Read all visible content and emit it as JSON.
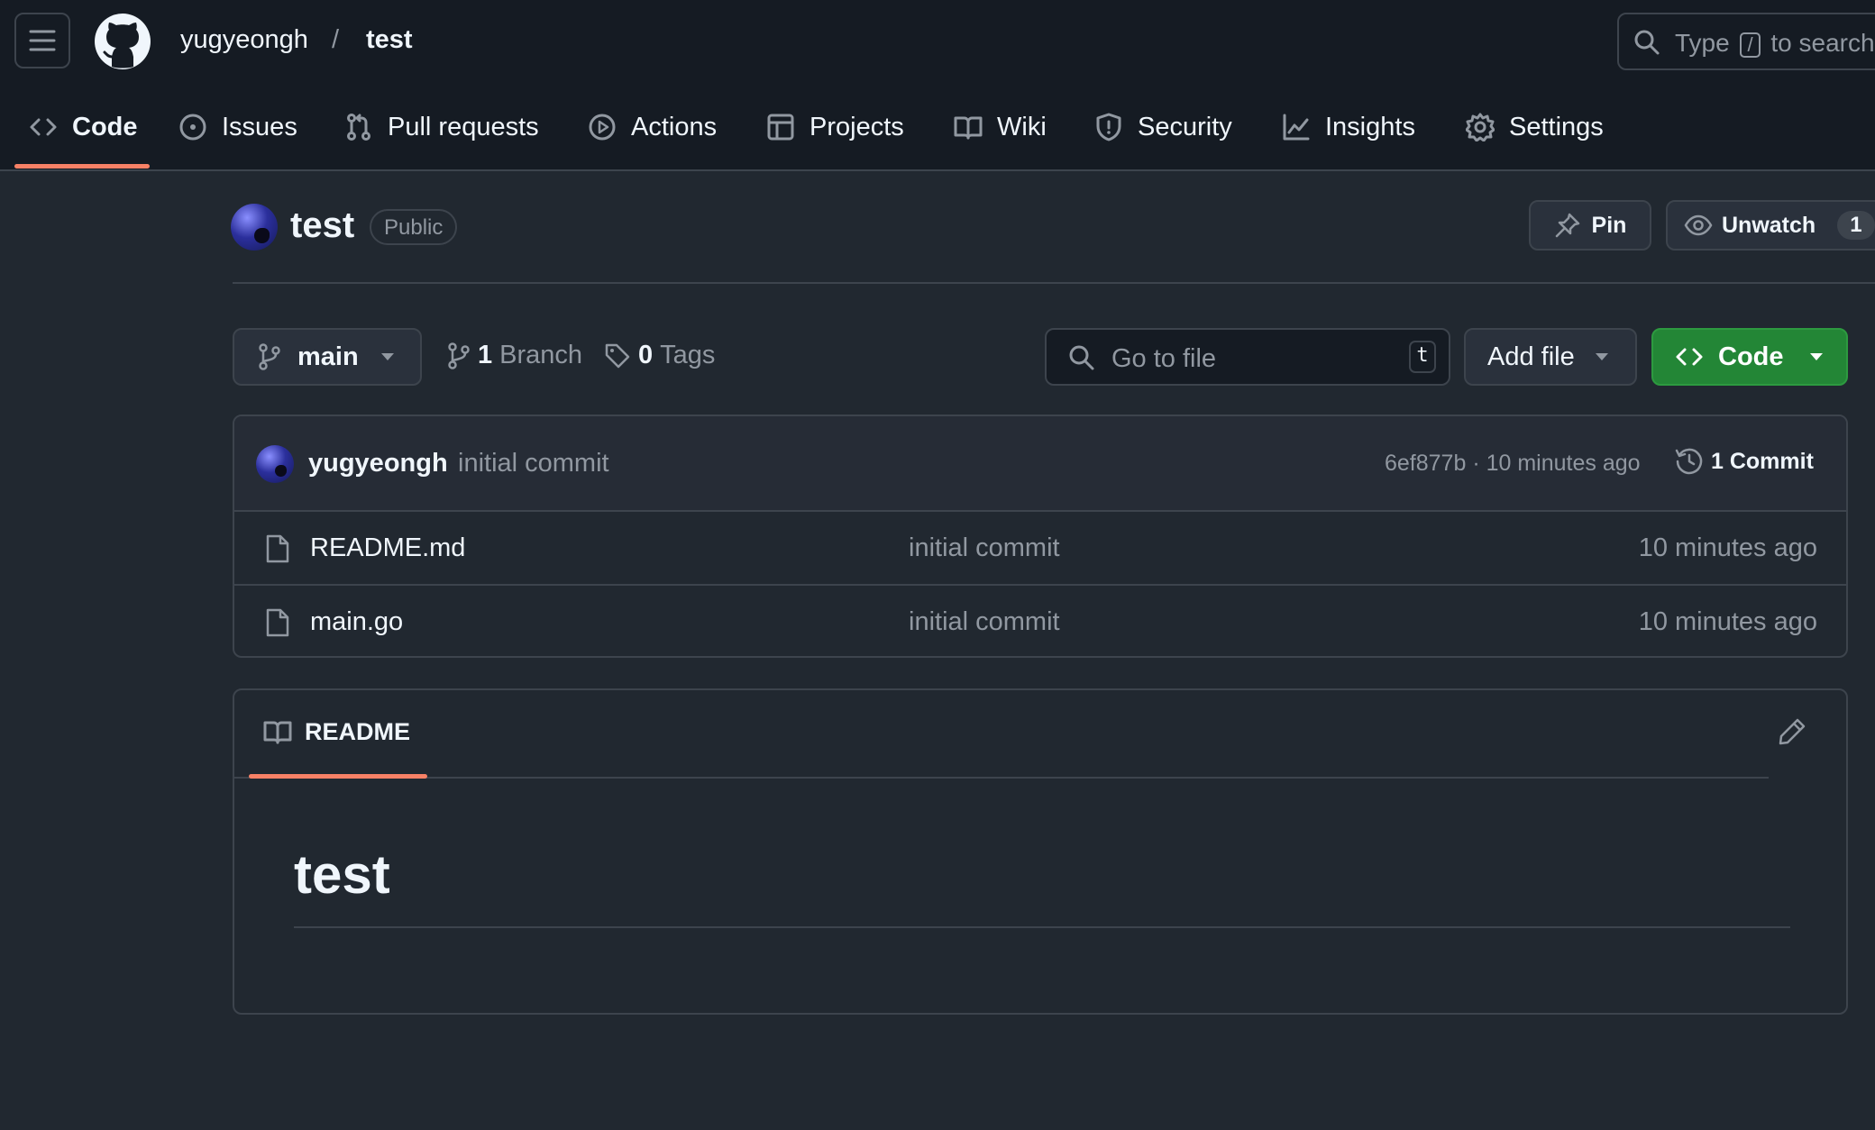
{
  "header": {
    "owner": "yugyeongh",
    "separator": "/",
    "repo": "test",
    "search_prefix": "Type",
    "search_key": "/",
    "search_suffix": "to search"
  },
  "nav": {
    "tabs": [
      {
        "label": "Code",
        "icon": "code-icon",
        "active": true
      },
      {
        "label": "Issues",
        "icon": "issue-icon"
      },
      {
        "label": "Pull requests",
        "icon": "pull-request-icon"
      },
      {
        "label": "Actions",
        "icon": "play-icon"
      },
      {
        "label": "Projects",
        "icon": "table-icon"
      },
      {
        "label": "Wiki",
        "icon": "book-icon"
      },
      {
        "label": "Security",
        "icon": "shield-icon"
      },
      {
        "label": "Insights",
        "icon": "graph-icon"
      },
      {
        "label": "Settings",
        "icon": "gear-icon"
      }
    ]
  },
  "repo": {
    "name": "test",
    "visibility": "Public",
    "pin_label": "Pin",
    "unwatch_label": "Unwatch",
    "watch_count": "1"
  },
  "toolbar": {
    "branch": "main",
    "branch_count": "1",
    "branch_label": "Branch",
    "tag_count": "0",
    "tag_label": "Tags",
    "goto_placeholder": "Go to file",
    "goto_key": "t",
    "add_file_label": "Add file",
    "code_label": "Code"
  },
  "commit": {
    "author": "yugyeongh",
    "message": "initial commit",
    "meta": "6ef877b · 10 minutes ago",
    "count_label": "1 Commit"
  },
  "files": [
    {
      "name": "README.md",
      "message": "initial commit",
      "age": "10 minutes ago"
    },
    {
      "name": "main.go",
      "message": "initial commit",
      "age": "10 minutes ago"
    }
  ],
  "readme": {
    "tab_label": "README",
    "heading": "test"
  },
  "colors": {
    "accent_underline": "#f78166",
    "code_button": "#238636",
    "background": "#212830",
    "header_background": "#151b23"
  }
}
